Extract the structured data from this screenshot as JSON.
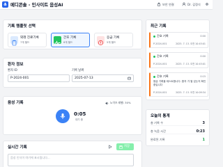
{
  "app": {
    "title": "메디콘솔 - 인사이트 음성AI"
  },
  "header": {
    "links": [
      {
        "label": "보안 연결",
        "icon": "lock-icon"
      },
      {
        "label": "Dr. 김정식",
        "icon": "user-icon"
      }
    ],
    "settings_icon": "gear-icon"
  },
  "templates": {
    "title": "기록 템플릿 선택",
    "items": [
      {
        "name": "외래 진료기록",
        "sub": "7개 필드",
        "color": "#3b82f6",
        "icon": "clipboard-icon"
      },
      {
        "name": "간호 기록",
        "sub": "6개 필드",
        "color": "#22c55e",
        "icon": "pulse-icon"
      },
      {
        "name": "응급 기록",
        "sub": "5개 필드",
        "color": "#ef4444",
        "icon": "alert-icon"
      }
    ]
  },
  "patient": {
    "title": "환자 정보",
    "id_label": "환자 ID",
    "id_value": "P-2024-001",
    "date_label": "기록 날짜",
    "date_value": "2025-07-13"
  },
  "voice": {
    "title": "음성 기록",
    "noise_label": "노이즈 레벨: 30%",
    "timer": "0:05",
    "status": "대기 중"
  },
  "realtime": {
    "title": "실시간 기록",
    "save_label": "저장",
    "placeholder": "음성 인식이 여기에 표시됩니다..."
  },
  "recent": {
    "title": "최근 기록",
    "items": [
      {
        "type": "간호 기록",
        "time": "0:00",
        "pid": "P-2024-001",
        "date": "2025. 7. 13. 오전 10:45:01",
        "text": ""
      },
      {
        "type": "간호 기록",
        "time": "0:00",
        "pid": "P-2024-001",
        "date": "2025. 7. 13. 오전 10:45:01",
        "text": ""
      },
      {
        "type": "간호 기록",
        "time": "0:15",
        "pid": "P-2024-001",
        "date": "2025. 7. 13. 오전 10:09:34",
        "text": "응급 기록을 테스트합니다. 환자 가 열 있는지 확인 중입니다"
      }
    ]
  },
  "stats": {
    "title": "오늘의 통계",
    "rows": [
      {
        "label": "총 기록 수",
        "value": "3",
        "color": "#111827"
      },
      {
        "label": "총 녹음 시간",
        "value": "0:23",
        "color": "#111827"
      },
      {
        "label": "완료된 기록",
        "value": "1",
        "color": "#16a34a"
      }
    ]
  }
}
